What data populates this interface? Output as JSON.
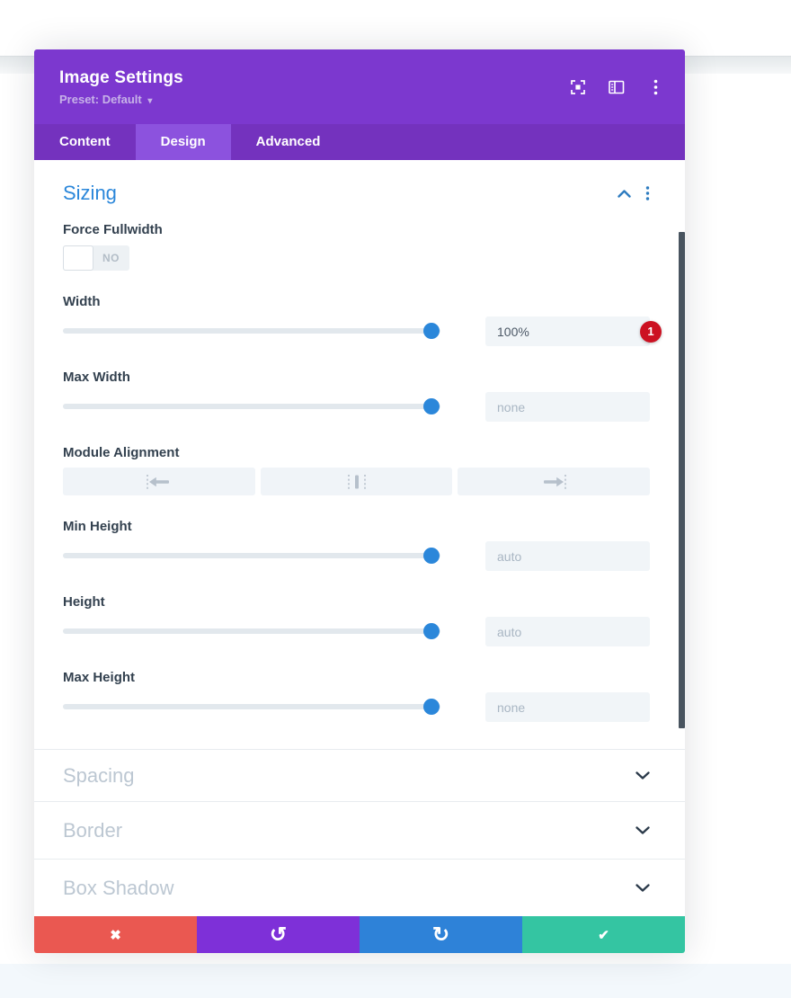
{
  "modal": {
    "title": "Image Settings",
    "preset_label": "Preset: Default",
    "preset_caret": "▾"
  },
  "tabs": [
    {
      "label": "Content",
      "active": false
    },
    {
      "label": "Design",
      "active": true
    },
    {
      "label": "Advanced",
      "active": false
    }
  ],
  "sizing": {
    "title": "Sizing",
    "force_fullwidth": {
      "label": "Force Fullwidth",
      "value": "NO"
    },
    "width": {
      "label": "Width",
      "value": "100%",
      "badge": "1",
      "slider_percent": 98
    },
    "max_width": {
      "label": "Max Width",
      "placeholder": "none",
      "slider_percent": 98
    },
    "module_alignment": {
      "label": "Module Alignment",
      "options": [
        "left",
        "center",
        "right"
      ]
    },
    "min_height": {
      "label": "Min Height",
      "placeholder": "auto",
      "slider_percent": 98
    },
    "height": {
      "label": "Height",
      "placeholder": "auto",
      "slider_percent": 98
    },
    "max_height": {
      "label": "Max Height",
      "placeholder": "none",
      "slider_percent": 98
    }
  },
  "collapsed_sections": [
    {
      "title": "Spacing"
    },
    {
      "title": "Border"
    },
    {
      "title": "Box Shadow"
    }
  ],
  "footer": {
    "discard_glyph": "✖",
    "undo_glyph": "↺",
    "redo_glyph": "↻",
    "save_glyph": "✔"
  },
  "colors": {
    "header_purple": "#7c38cf",
    "tabbar_purple": "#7432be",
    "active_tab_purple": "#8c52de",
    "accent_blue": "#2b87da",
    "badge_red": "#cc1122",
    "discard_red": "#ea5851",
    "undo_purple": "#7e30d8",
    "redo_blue": "#2e82d8",
    "save_green": "#34c5a2",
    "label_dark": "#33414f",
    "muted_heading": "#bcc7d2"
  }
}
